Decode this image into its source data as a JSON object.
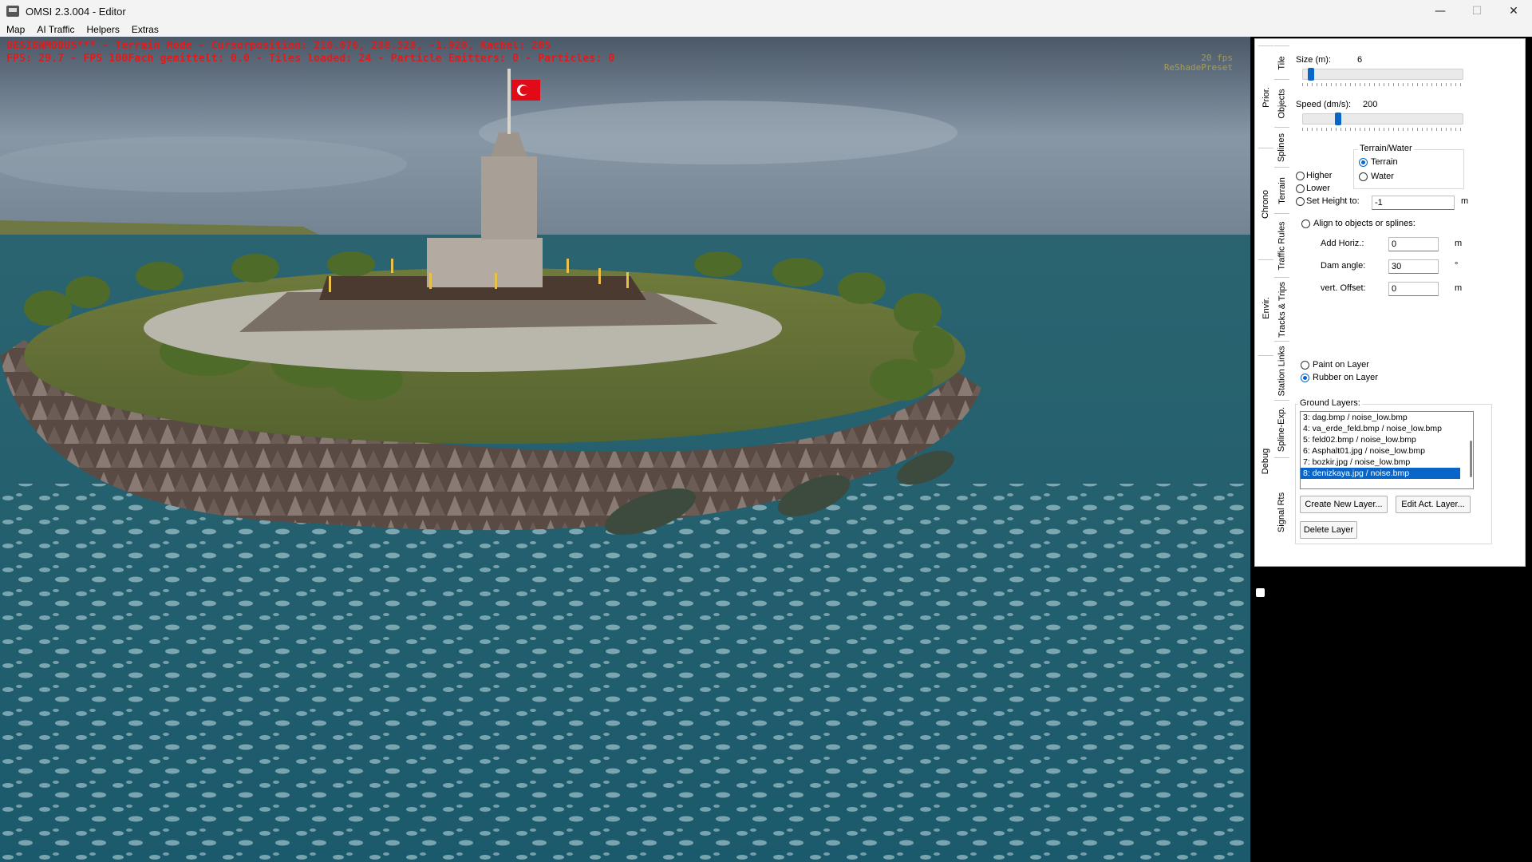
{
  "window": {
    "title": "OMSI 2.3.004 - Editor",
    "controls": {
      "minimize": "—",
      "maximize": "☐",
      "close": "✕"
    }
  },
  "menu": [
    "Map",
    "AI Traffic",
    "Helpers",
    "Extras"
  ],
  "viewport": {
    "hud_line1": "DESIGNMODUS*** - Terrain Mode - Cursorposition: 210.076, 288.528, -1.920, Kachel: 205",
    "hud_line2": "FPS: 29.7 - FPS 100Fach gemittelt: 0.0 - Tiles loaded: 24 - Particle Emitters: 0 - Particles: 0",
    "overlay_line1": "20 fps",
    "overlay_line2": "ReShadePreset",
    "colors": {
      "hud": "#e21a1a",
      "sea": "#1f5f6e",
      "flag": "#e30a17"
    }
  },
  "tabs_outer": [
    "Tile",
    "Objects",
    "Splines",
    "Terrain",
    "Traffic Rules",
    "Tracks & Trips",
    "Station Links",
    "Spline-Exp.",
    "Signal Rts"
  ],
  "tabs_inner": [
    "Prior.",
    "Chrono",
    "Envir.",
    "Debug"
  ],
  "active_tab": "Terrain",
  "terrain": {
    "size_label": "Size (m):",
    "size_value": "6",
    "size_slider": 0.03,
    "speed_label": "Speed (dm/s):",
    "speed_value": "200",
    "speed_slider": 0.21,
    "tw_group_label": "Terrain/Water",
    "tw_options": [
      "Terrain",
      "Water"
    ],
    "mode_options": [
      "Higher",
      "Lower",
      "Set Height to:"
    ],
    "set_height_value": "-1",
    "set_height_unit": "m",
    "align_label": "Align to objects or splines:",
    "add_horiz_label": "Add Horiz.:",
    "add_horiz_value": "0",
    "add_horiz_unit": "m",
    "dam_angle_label": "Dam angle:",
    "dam_angle_value": "30",
    "dam_angle_unit": "°",
    "vert_offset_label": "vert. Offset:",
    "vert_offset_value": "0",
    "vert_offset_unit": "m",
    "paint_label": "Paint on Layer",
    "rubber_label": "Rubber on Layer",
    "ground_layers_label": "Ground Layers:",
    "layers": [
      "3: dag.bmp / noise_low.bmp",
      "4: va_erde_feld.bmp / noise_low.bmp",
      "5: feld02.bmp / noise_low.bmp",
      "6: Asphalt01.jpg / noise_low.bmp",
      "7: bozkir.jpg / noise_low.bmp",
      "8: denizkaya.jpg / noise.bmp"
    ],
    "selected_layer": "8: denizkaya.jpg / noise.bmp",
    "create_button": "Create New Layer...",
    "edit_button": "Edit Act. Layer...",
    "delete_button": "Delete Layer",
    "accent": "#0a65c8"
  }
}
